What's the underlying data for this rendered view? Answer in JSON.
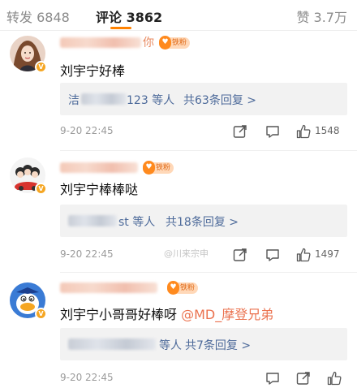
{
  "tabs": {
    "repost": "转发 6848",
    "comment": "评论 3862",
    "like": "赞 3.7万"
  },
  "colors": {
    "accent": "#ff8200",
    "mention": "#eb7350",
    "reply_link": "#4d6a9a"
  },
  "watermark": "@川来宗申",
  "comments": [
    {
      "name_tail": "你",
      "fan_badge": "铁粉",
      "text": "刘宇宁好棒",
      "reply_visible_prefix": "洁",
      "reply_users": "123 等人",
      "reply_link": "共63条回复 >",
      "time": "9-20 22:45",
      "likes": "1548"
    },
    {
      "name_tail": "",
      "fan_badge": "铁粉",
      "text": "刘宇宁棒棒哒",
      "reply_visible_prefix": "",
      "reply_users": "st 等人",
      "reply_link": "共18条回复 >",
      "time": "9-20 22:45",
      "likes": "1497"
    },
    {
      "name_tail": "",
      "fan_badge": "铁粉",
      "text": "刘宇宁小哥哥好棒呀 ",
      "mention": "@MD_摩登兄弟",
      "reply_visible_prefix": "",
      "reply_users": "等人",
      "reply_link": "共7条回复 >",
      "time": "9-20 22:45",
      "likes": ""
    }
  ],
  "icons": [
    "share-icon",
    "comment-icon",
    "like-icon",
    "verified-badge-icon",
    "fan-heart-icon"
  ]
}
